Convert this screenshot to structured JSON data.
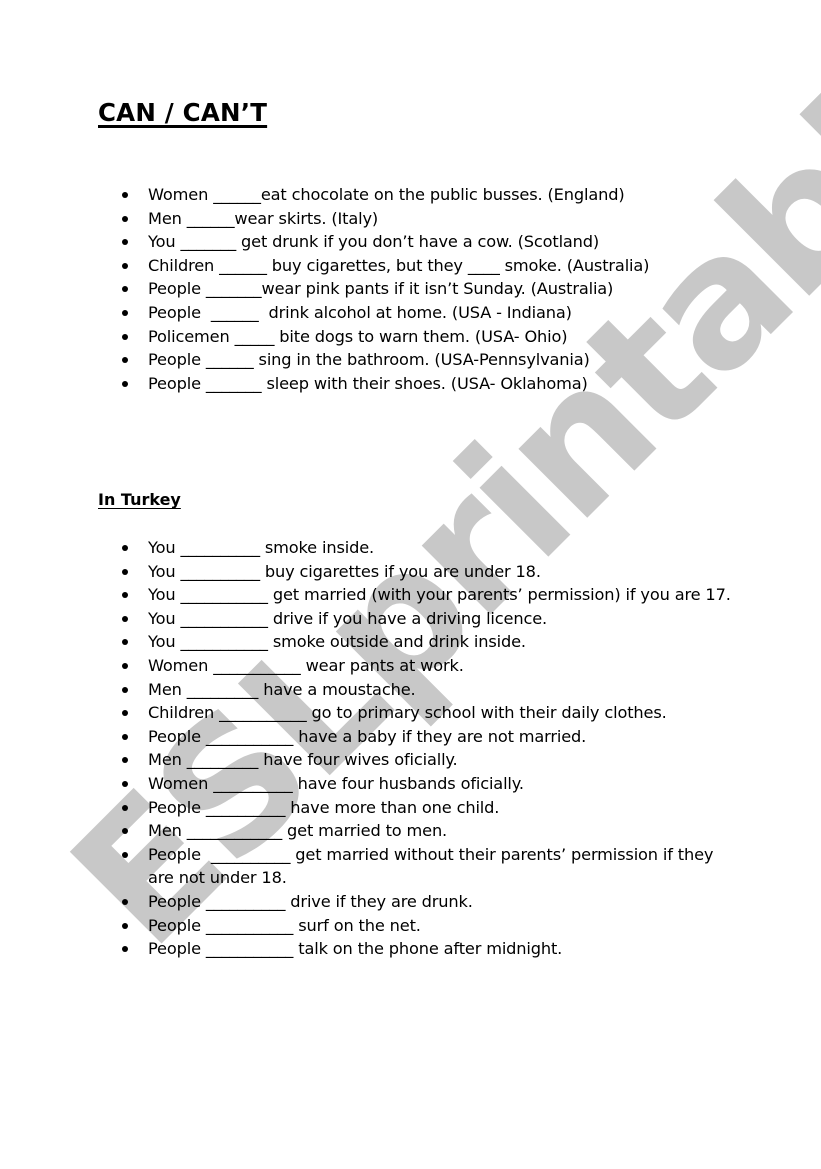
{
  "title": "CAN / CAN’T",
  "watermark": "ESLprintables.com",
  "section1": {
    "items": [
      "Women ______eat chocolate on the public busses. (England)",
      "Men ______wear skirts. (Italy)",
      "You _______ get drunk if you don’t have a cow. (Scotland)",
      "Children ______ buy cigarettes, but they ____ smoke. (Australia)",
      "People _______wear pink pants if it isn’t Sunday. (Australia)",
      "People  ______  drink alcohol at home. (USA - Indiana)",
      "Policemen _____ bite dogs to warn them. (USA- Ohio)",
      "People ______ sing in the bathroom. (USA-Pennsylvania)",
      "People _______ sleep with their shoes. (USA- Oklahoma)"
    ]
  },
  "section2": {
    "heading": "In Turkey",
    "items": [
      "You __________ smoke inside.",
      "You __________ buy cigarettes if you are under 18.",
      "You ___________ get married (with your parents’ permission) if you are 17.",
      "You ___________ drive if you have a driving licence.",
      "You ___________ smoke outside and drink inside.",
      "Women ___________ wear pants at work.",
      "Men _________ have a moustache.",
      "Children ___________ go to primary school with their daily clothes.",
      "People ___________ have a baby if they are not married.",
      "Men _________ have four wives oficially.",
      "Women __________ have four husbands oficially.",
      "People __________ have more than one child.",
      "Men ____________ get married to men.",
      "People  __________ get married without their parents’ permission if they are not under 18.",
      "People __________ drive if they are drunk.",
      "People ___________ surf on the net.",
      "People ___________ talk on the phone after midnight."
    ]
  }
}
